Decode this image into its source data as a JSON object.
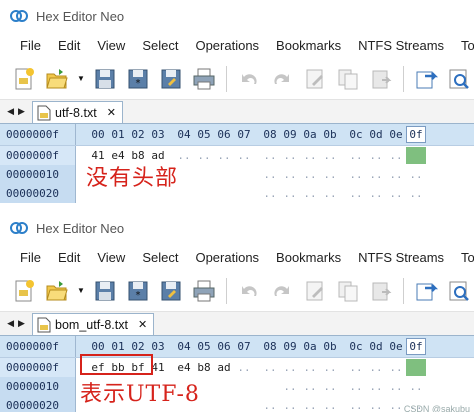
{
  "app_title": "Hex Editor Neo",
  "menu": [
    "File",
    "Edit",
    "View",
    "Select",
    "Operations",
    "Bookmarks",
    "NTFS Streams",
    "Too"
  ],
  "toolbar_icons": [
    "new-file-icon",
    "open-file-icon",
    "open-dropdown-icon",
    "save-icon",
    "save-all-icon",
    "save-as-icon",
    "print-icon",
    "undo-icon",
    "redo-icon",
    "edit-icon",
    "copy-icon",
    "paste-icon",
    "export-icon",
    "find-icon"
  ],
  "header_offset": "0000000f",
  "column_headers": [
    "00",
    "01",
    "02",
    "03",
    "04",
    "05",
    "06",
    "07",
    "08",
    "09",
    "0a",
    "0b",
    "0c",
    "0d",
    "0e",
    "0f"
  ],
  "panes": [
    {
      "tab_label": "utf-8.txt",
      "rows": [
        {
          "offset": "0000000f",
          "bytes": [
            "41",
            "e4",
            "b8",
            "ad",
            "..",
            "..",
            "..",
            "..",
            "..",
            "..",
            "..",
            "..",
            "..",
            "..",
            "..",
            ""
          ]
        },
        {
          "offset": "00000010",
          "bytes": [
            ".",
            "",
            "",
            "",
            "",
            "",
            "",
            "",
            "..",
            "..",
            "..",
            "..",
            "..",
            "..",
            "..",
            ".."
          ]
        },
        {
          "offset": "00000020",
          "bytes": [
            "",
            "",
            "",
            "",
            "",
            "",
            "",
            "",
            "..",
            "..",
            "..",
            "..",
            "..",
            "..",
            "..",
            ".."
          ]
        }
      ],
      "annotation": "没有头部"
    },
    {
      "tab_label": "bom_utf-8.txt",
      "rows": [
        {
          "offset": "0000000f",
          "bytes": [
            "ef",
            "bb",
            "bf",
            "41",
            "e4",
            "b8",
            "ad",
            "..",
            "..",
            "..",
            "..",
            "..",
            "..",
            "..",
            "..",
            ""
          ]
        },
        {
          "offset": "00000010",
          "bytes": [
            "",
            "",
            "",
            "",
            "",
            "",
            "",
            "",
            "",
            "..",
            "..",
            "..",
            "..",
            "..",
            "..",
            ".."
          ]
        },
        {
          "offset": "00000020",
          "bytes": [
            "",
            "",
            "",
            "",
            "",
            "",
            "",
            "",
            "..",
            "..",
            "..",
            "..",
            "..",
            "..",
            "..",
            ".."
          ]
        }
      ],
      "annotation": "表示UTF-8"
    }
  ],
  "watermark": "CSDN @sakubu",
  "colors": {
    "header_bg": "#cfe3f4",
    "offset_bg": "#d6e7f7",
    "cursor": "#7fbf7f",
    "annotation": "#d6231b"
  }
}
